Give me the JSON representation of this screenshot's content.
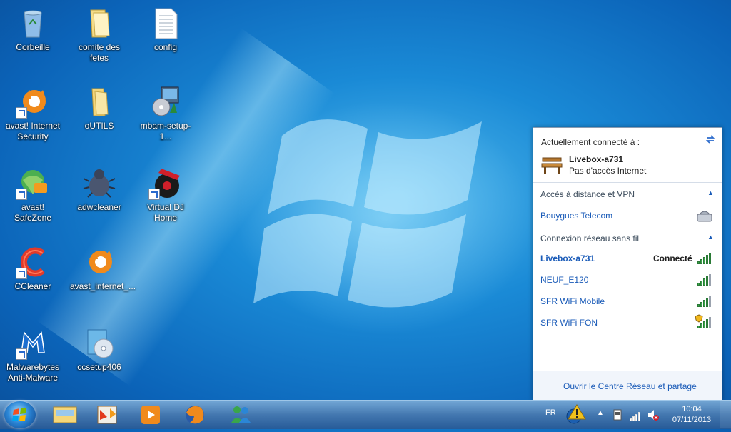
{
  "desktop": {
    "icons": [
      {
        "label": "Corbeille",
        "icon": "recycle-bin-icon"
      },
      {
        "label": "comite des fetes",
        "icon": "folder-icon"
      },
      {
        "label": "config",
        "icon": "text-file-icon"
      },
      {
        "label": "avast! Internet Security",
        "icon": "avast-icon"
      },
      {
        "label": "oUTILS",
        "icon": "folder-icon"
      },
      {
        "label": "mbam-setup-1...",
        "icon": "installer-icon"
      },
      {
        "label": "avast! SafeZone",
        "icon": "safezone-icon"
      },
      {
        "label": "adwcleaner",
        "icon": "bug-icon"
      },
      {
        "label": "Virtual DJ Home",
        "icon": "vinyl-icon"
      },
      {
        "label": "CCleaner",
        "icon": "ccleaner-icon"
      },
      {
        "label": "avast_internet_...",
        "icon": "avast-icon"
      },
      {
        "label": "Malwarebytes Anti-Malware",
        "icon": "malwarebytes-icon"
      },
      {
        "label": "ccsetup406",
        "icon": "setup-disc-icon"
      }
    ]
  },
  "network_panel": {
    "connected_header": "Actuellement connecté à :",
    "current": {
      "name": "Livebox-a731",
      "status": "Pas d'accès Internet"
    },
    "vpn_section": "Accès à distance et VPN",
    "vpn_items": [
      "Bouygues Telecom"
    ],
    "wireless_section": "Connexion réseau sans fil",
    "wireless": [
      {
        "name": "Livebox-a731",
        "status": "Connecté",
        "signal": 5,
        "secured": false
      },
      {
        "name": "NEUF_E120",
        "status": "",
        "signal": 4,
        "secured": false
      },
      {
        "name": "SFR WiFi Mobile",
        "status": "",
        "signal": 4,
        "secured": false
      },
      {
        "name": "SFR WiFi FON",
        "status": "",
        "signal": 4,
        "secured": true
      }
    ],
    "footer_link": "Ouvrir le Centre Réseau et partage"
  },
  "taskbar": {
    "apps": [
      "explorer-icon",
      "office-icon",
      "media-player-icon",
      "firefox-icon",
      "messenger-icon"
    ],
    "language": "FR",
    "time": "10:04",
    "date": "07/11/2013"
  },
  "colors": {
    "accent": "#1a5bb8",
    "signal": "#3aa64b"
  }
}
